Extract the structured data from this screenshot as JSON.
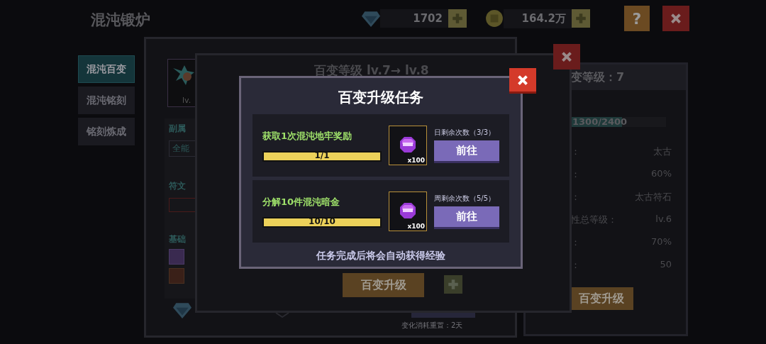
{
  "header": {
    "title": "混沌锻炉",
    "currencies": [
      {
        "kind": "gem",
        "value": "1702"
      },
      {
        "kind": "coin",
        "value": "164.2万"
      }
    ],
    "help_button": "?"
  },
  "side_tabs": [
    {
      "label": "混沌百变",
      "selected": true
    },
    {
      "label": "混沌铭刻",
      "selected": false
    },
    {
      "label": "铭刻炼成",
      "selected": false
    }
  ],
  "main_panel": {
    "item_level": "lv.",
    "sub_attr_label": "副属",
    "sub_attr_chip": "全能",
    "rune_label": "符文",
    "base_label": "基础",
    "reset_note": "变化消耗重置：2天"
  },
  "level_dialog": {
    "title": "百变等级 lv.7→ lv.8",
    "upgrade_button": "百变升级"
  },
  "info_panel": {
    "header": "变等级：7",
    "progress": {
      "level": 0.54,
      "reading": "1300/2400"
    },
    "rows": [
      {
        "label": "：",
        "value": "太古"
      },
      {
        "label": "：",
        "value": "60%"
      },
      {
        "label": "：",
        "value": "太古符石"
      },
      {
        "label": "性总等级：",
        "value": "lv.6"
      },
      {
        "label": "：",
        "value": "70%"
      },
      {
        "label": "：",
        "value": "50"
      }
    ],
    "button": "百变升级"
  },
  "task_dialog": {
    "title": "百变升级任务",
    "tasks": [
      {
        "text": "获取1次混沌地牢奖励",
        "progress": {
          "level": 1,
          "reading": "1/1"
        },
        "reward_count": "x100",
        "limit": "日剩余次数（3/3）",
        "button": "前往"
      },
      {
        "text": "分解10件混沌暗金",
        "progress": {
          "level": 1,
          "reading": "10/10"
        },
        "reward_count": "x100",
        "limit": "周剩余次数（5/5）",
        "button": "前往"
      }
    ],
    "footer": "任务完成后将会自动获得经验"
  }
}
